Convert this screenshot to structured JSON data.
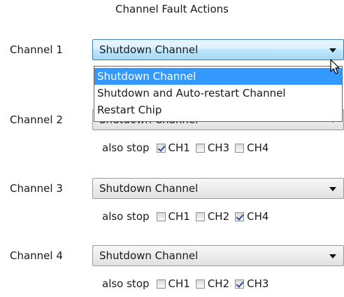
{
  "title": "Channel Fault Actions",
  "channels": [
    {
      "label": "Channel 1",
      "selected": "Shutdown Channel",
      "open": true
    },
    {
      "label": "Channel 2",
      "selected": "Shutdown Channel",
      "also_stop_label": "also stop",
      "checks": [
        {
          "label": "CH1",
          "checked": true
        },
        {
          "label": "CH3",
          "checked": false
        },
        {
          "label": "CH4",
          "checked": false
        }
      ]
    },
    {
      "label": "Channel 3",
      "selected": "Shutdown Channel",
      "also_stop_label": "also stop",
      "checks": [
        {
          "label": "CH1",
          "checked": false
        },
        {
          "label": "CH2",
          "checked": false
        },
        {
          "label": "CH4",
          "checked": true
        }
      ]
    },
    {
      "label": "Channel 4",
      "selected": "Shutdown Channel",
      "also_stop_label": "also stop",
      "checks": [
        {
          "label": "CH1",
          "checked": false
        },
        {
          "label": "CH2",
          "checked": false
        },
        {
          "label": "CH3",
          "checked": true
        }
      ]
    }
  ],
  "dropdown_options": [
    "Shutdown Channel",
    "Shutdown and Auto-restart Channel",
    "Restart Chip"
  ],
  "dropdown_highlighted": "Shutdown Channel",
  "colors": {
    "highlight": "#3399ff",
    "open_border": "#3c7fb1",
    "check": "#2a4d9b"
  },
  "icons": {
    "cursor": "arrow-cursor-icon",
    "dropdown": "chevron-down-icon"
  }
}
